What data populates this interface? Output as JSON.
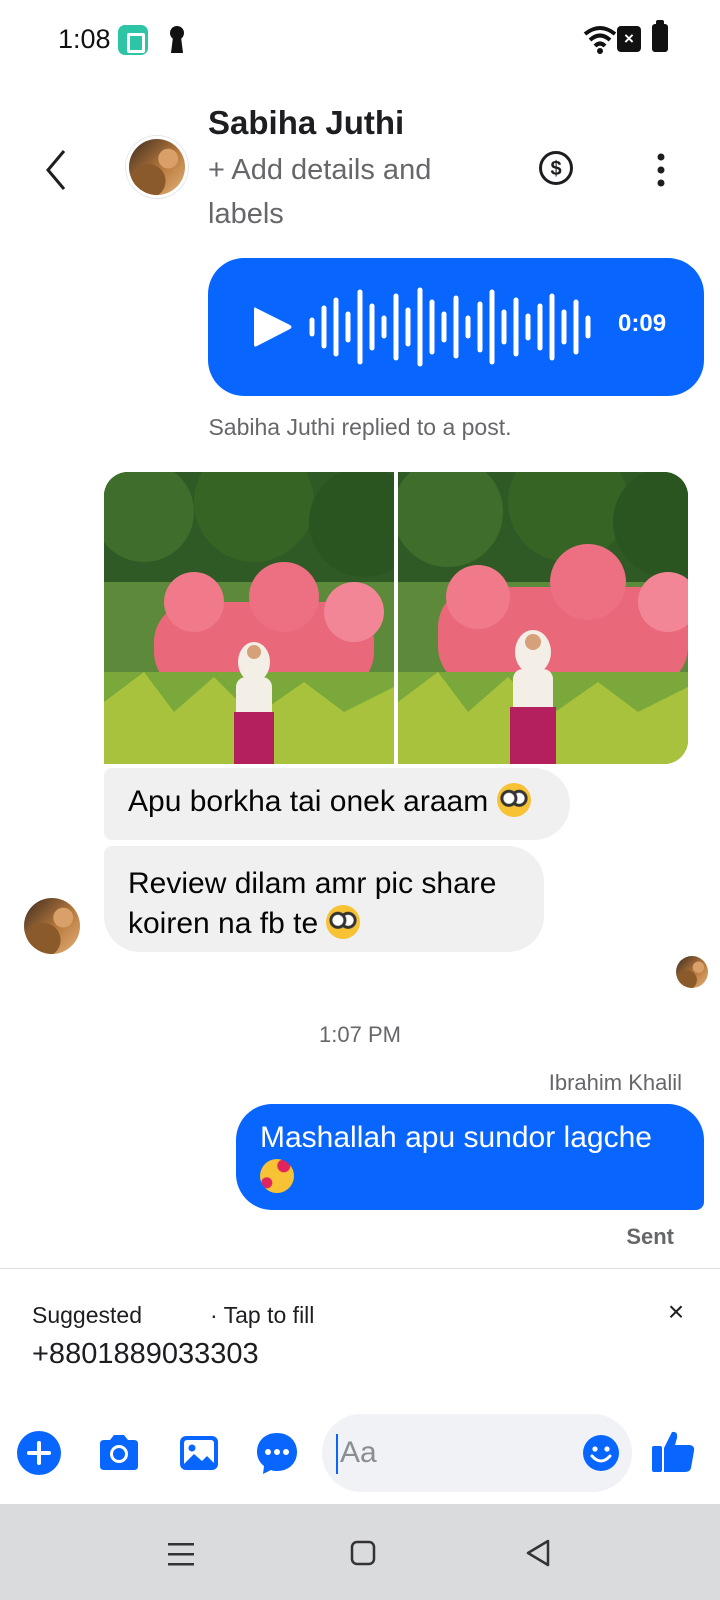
{
  "status_bar": {
    "time": "1:08"
  },
  "header": {
    "contact_name": "Sabiha Juthi",
    "subtitle": "+ Add details and labels"
  },
  "voice_message": {
    "duration": "0:09"
  },
  "reply_note": "Sabiha Juthi replied to a post.",
  "messages": {
    "incoming_1": "Apu borkha tai onek araam",
    "incoming_2": "Review dilam amr pic share koiren na fb te",
    "timestamp": "1:07 PM",
    "outgoing_sender": "Ibrahim Khalil",
    "outgoing_1": "Mashallah apu sundor lagche",
    "status": "Sent"
  },
  "suggestion": {
    "label": "Suggested",
    "hint": "· Tap to fill",
    "value": "+8801889033303",
    "close": "×"
  },
  "composer": {
    "placeholder": "Aa"
  },
  "colors": {
    "accent": "#0866ff",
    "incoming_bubble": "#f0f0f0",
    "secondary_text": "#65676b"
  },
  "icons": [
    "back-arrow-icon",
    "dollar-icon",
    "more-vertical-icon",
    "play-icon",
    "plus-icon",
    "camera-icon",
    "gallery-icon",
    "chat-bubble-icon",
    "emoji-icon",
    "like-icon"
  ]
}
